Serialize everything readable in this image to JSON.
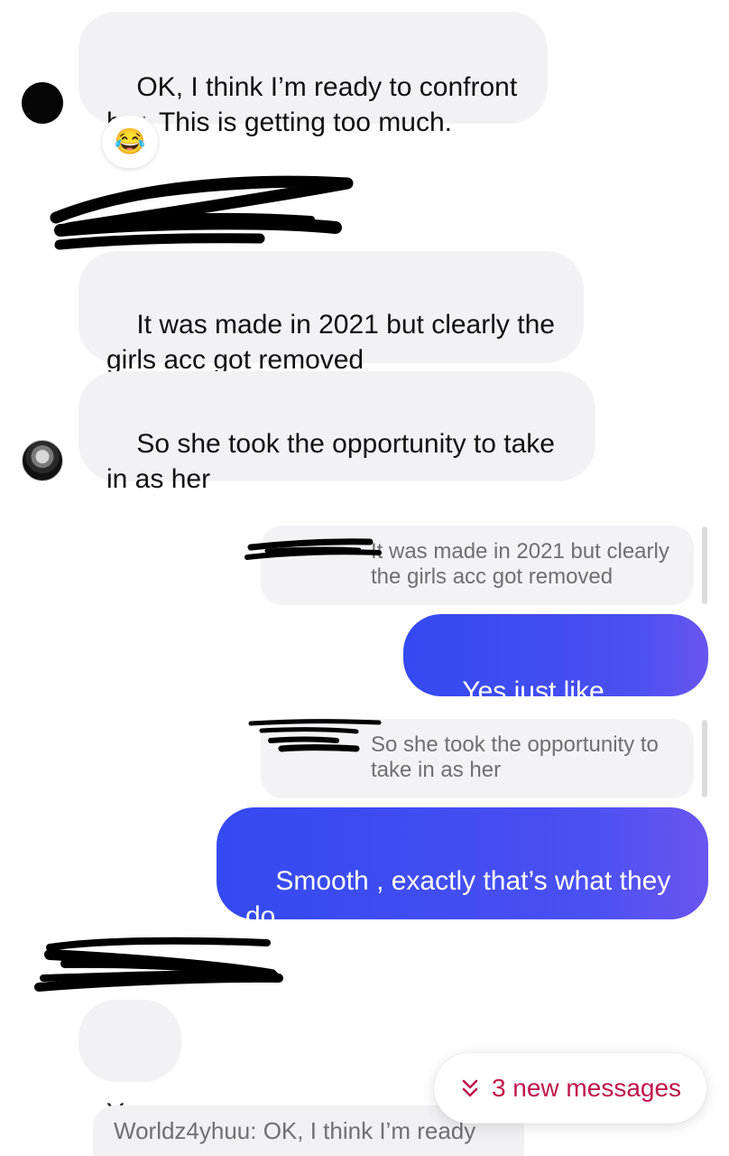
{
  "messages": {
    "incoming_1": "OK, I think I’m ready to confront her. This is getting too much.",
    "reaction_emoji": "😂",
    "incoming_2": "It was made in 2021 but clearly the girls acc got removed",
    "incoming_3": "So she took the opportunity to take in as her",
    "reply_1_quote": "It was made in 2021 but clearly the girls acc got removed",
    "outgoing_1": "Yes just like Cereza",
    "reply_2_quote": "So she took the opportunity to take in as her",
    "outgoing_2": "Smooth , exactly that’s what they do",
    "incoming_4": "Yea",
    "bottom_preview": "Worldz4yhuu: OK, I think I’m ready"
  },
  "new_messages": {
    "label": "3 new messages",
    "icon": "chevrons-down-icon"
  },
  "colors": {
    "incoming_bubble": "#f2f2f4",
    "outgoing_start": "#3449f0",
    "outgoing_end": "#6a55f0",
    "new_messages_text": "#c0164b",
    "redaction_ink": "#000000"
  }
}
